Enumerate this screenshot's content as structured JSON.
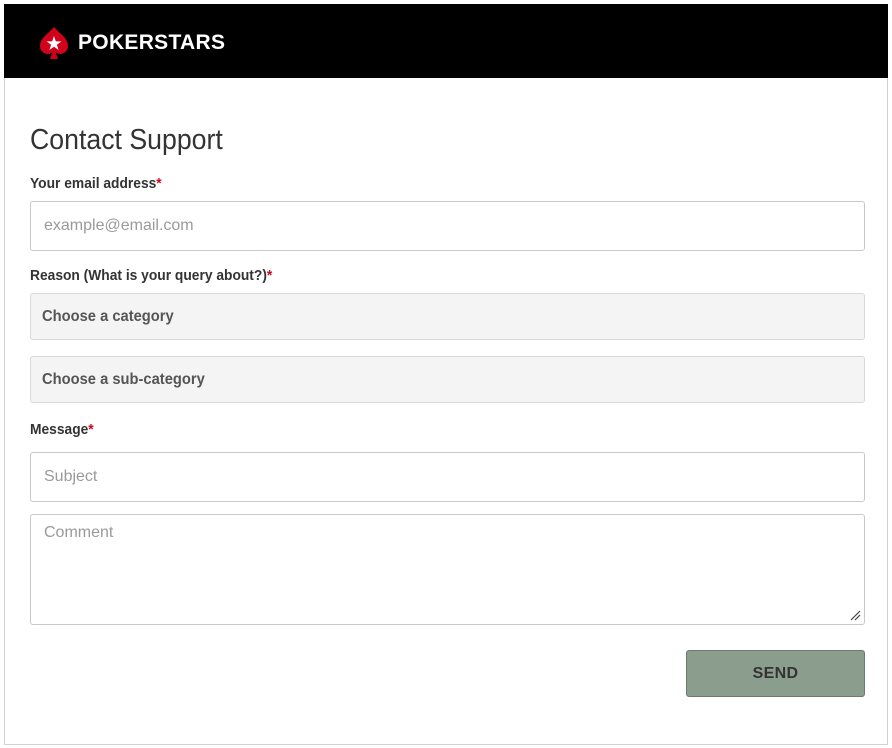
{
  "brand": {
    "name": "POKERSTARS",
    "header_bg": "#000000",
    "logo_red": "#d0021b",
    "logo_icon": "spade-star-icon"
  },
  "form": {
    "title": "Contact Support",
    "email": {
      "label": "Your email address",
      "required_mark": "*",
      "placeholder": "example@email.com",
      "value": ""
    },
    "reason": {
      "label": "Reason (What is your query about?)",
      "required_mark": "*",
      "category_placeholder": "Choose a category",
      "subcategory_placeholder": "Choose a sub-category"
    },
    "message": {
      "label": "Message",
      "required_mark": "*",
      "subject_placeholder": "Subject",
      "comment_placeholder": "Comment"
    },
    "send_label": "SEND",
    "send_color": "#8b9e8e",
    "required_color": "#d0021b"
  }
}
